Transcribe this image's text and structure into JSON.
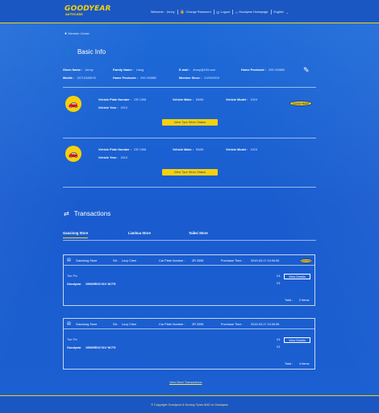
{
  "header": {
    "brand": "GOODYEAR",
    "brand_sub": "AUTOCARE",
    "welcome_label": "Welcome :",
    "user": "Jenny",
    "change_password": "Change Password",
    "logout": "Logout",
    "homepage": "Goodyear Homepage",
    "language": "English"
  },
  "breadcrumb": "Member Center",
  "basic_info": {
    "title": "Basic Info",
    "given_name_label": "Given Name :",
    "given_name": "Jenny",
    "family_name_label": "Family Name :",
    "family_name": "Liang",
    "email_label": "E-mail :",
    "email": "Jenny@163.com",
    "home_postcode_label": "Home Postcode :",
    "home_postcode": "200 000882",
    "mobile_label": "Mobile :",
    "mobile": "18712345678",
    "home_postcode2_label": "Home Postcode :",
    "home_postcode2": "200 000882",
    "member_since_label": "Member Since :",
    "member_since": "21/09/2019"
  },
  "vehicles": [
    {
      "plate_label": "Vehicle Plate Number :",
      "plate": "GR 1398",
      "make_label": "Vehicle Make :",
      "make": "BMW",
      "model_label": "Vehicle Model :",
      "model": "X4Ol",
      "year_label": "Vehicle Year :",
      "year": "2019",
      "button": "View Tyre Worn Status",
      "badge": "GOODYEAR"
    },
    {
      "plate_label": "Vehicle Plate Number :",
      "plate": "GR 1398",
      "make_label": "Vehicle Make :",
      "make": "BMW",
      "model_label": "Vehicle Model :",
      "model": "X4Ol",
      "year_label": "Vehicle Year :",
      "year": "2019",
      "button": "View Tyre Worn Status"
    }
  ],
  "transactions": {
    "title": "Transactions",
    "tabs": [
      "Gaoxiong Store",
      "Lianhua Store",
      "Taibei Store"
    ],
    "cards": [
      {
        "store": "Gaoxiong Store",
        "sa_label": "SA :",
        "sa": "Lucy Chen",
        "plate_label": "Car Plate Number :",
        "plate": "2R 3398",
        "time_label": "Purchase Time :",
        "time": "2019-03-17 10:30:05",
        "badge": "GOODYEAR",
        "item_type": "Tire Pix",
        "brand": "Goodyear",
        "product": "195/65R15 91V NCT5",
        "qty1": "X1",
        "qty2": "X1",
        "details_button": "View Details",
        "total_label": "Total :",
        "total": "2 Items"
      },
      {
        "store": "Gaoxiong Store",
        "sa_label": "SA :",
        "sa": "Lucy Chen",
        "plate_label": "Car Plate Number :",
        "plate": "2R 3398",
        "time_label": "Purchase Time :",
        "time": "2019-03-17 10:30:05",
        "item_type": "Tire Pix",
        "brand": "Goodyear",
        "product": "195/65R15 91V NCT5",
        "qty1": "X1",
        "qty2": "X1",
        "details_button": "View Details",
        "total_label": "Total :",
        "total": "4 Items"
      }
    ],
    "more_link": "View More Transactions"
  },
  "footer": "© Copyright Goodyear & Dunlop Tyres AND to Goodyear",
  "colors": {
    "accent": "#f6d10b",
    "background": "#1a5ccf",
    "header": "#1b57c2"
  }
}
